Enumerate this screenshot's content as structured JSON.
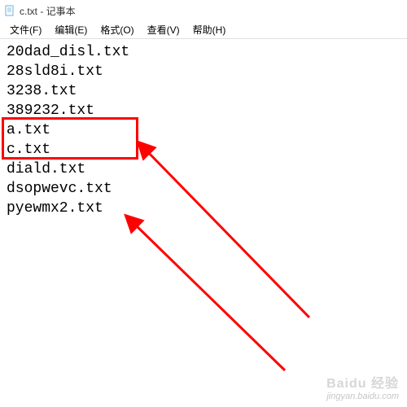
{
  "titlebar": {
    "title": "c.txt - 记事本"
  },
  "menu": {
    "file": "文件(F)",
    "edit": "编辑(E)",
    "format": "格式(O)",
    "view": "查看(V)",
    "help": "帮助(H)"
  },
  "content_lines": {
    "l0": "20dad_disl.txt",
    "l1": "28sld8i.txt",
    "l2": "3238.txt",
    "l3": "389232.txt",
    "l4": "a.txt",
    "l5": "c.txt",
    "l6": "diald.txt",
    "l7": "dsopwevc.txt",
    "l8": "pyewmx2.txt"
  },
  "watermark": {
    "brand": "Baidu 经验",
    "url": "jingyan.baidu.com"
  }
}
